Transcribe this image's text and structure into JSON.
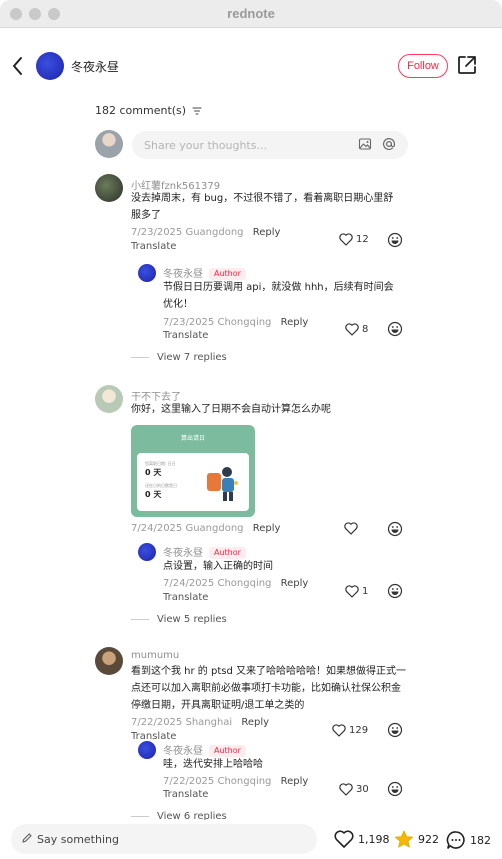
{
  "window": {
    "title": "rednote"
  },
  "header": {
    "author_name": "冬夜永昼",
    "follow_label": "Follow"
  },
  "comments_header": {
    "count_label": "182 comment(s)"
  },
  "comment_input": {
    "placeholder": "Share your thoughts..."
  },
  "comments": [
    {
      "user": "小红薯fznk561379",
      "text": "没去掉周末，有 bug，不过很不错了，看着离职日期心里舒服多了",
      "date": "7/23/2025",
      "location": "Guangdong",
      "reply_label": "Reply",
      "translate_label": "Translate",
      "likes": "12",
      "reply": {
        "user": "冬夜永昼",
        "tag": "Author",
        "text": "节假日日历要调用 api，就没做 hhh，后续有时间会优化！",
        "date": "7/23/2025",
        "location": "Chongqing",
        "reply_label": "Reply",
        "translate_label": "Translate",
        "likes": "8"
      },
      "view_replies": "View 7 replies"
    },
    {
      "user": "干不下去了",
      "text": "你好，这里输入了日期不会自动计算怎么办呢",
      "image": {
        "title": "算出请日",
        "label1": "您离职日期: 日日",
        "value1": "0 天",
        "label2": "还在日的日数是日",
        "value2": "0 天"
      },
      "date": "7/24/2025",
      "location": "Guangdong",
      "reply_label": "Reply",
      "likes": "",
      "reply": {
        "user": "冬夜永昼",
        "tag": "Author",
        "text": "点设置，输入正确的时间",
        "date": "7/24/2025",
        "location": "Chongqing",
        "reply_label": "Reply",
        "translate_label": "Translate",
        "likes": "1"
      },
      "view_replies": "View 5 replies"
    },
    {
      "user": "mumumu",
      "text": "看到这个我 hr 的 ptsd 又来了哈哈哈哈哈！如果想做得正式一点还可以加入离职前必做事项打卡功能，比如确认社保公积金停缴日期，开具离职证明/退工单之类的",
      "date": "7/22/2025",
      "location": "Shanghai",
      "reply_label": "Reply",
      "translate_label": "Translate",
      "likes": "129",
      "reply": {
        "user": "冬夜永昼",
        "tag": "Author",
        "text": "哇，迭代安排上哈哈哈",
        "date": "7/22/2025",
        "location": "Chongqing",
        "reply_label": "Reply",
        "translate_label": "Translate",
        "likes": "30"
      },
      "view_replies": "View 6 replies"
    }
  ],
  "bottom_bar": {
    "placeholder": "Say something",
    "likes": "1,198",
    "favorites": "922",
    "comments": "182"
  },
  "colors": {
    "accent": "#ff2442",
    "star": "#f5b800"
  }
}
